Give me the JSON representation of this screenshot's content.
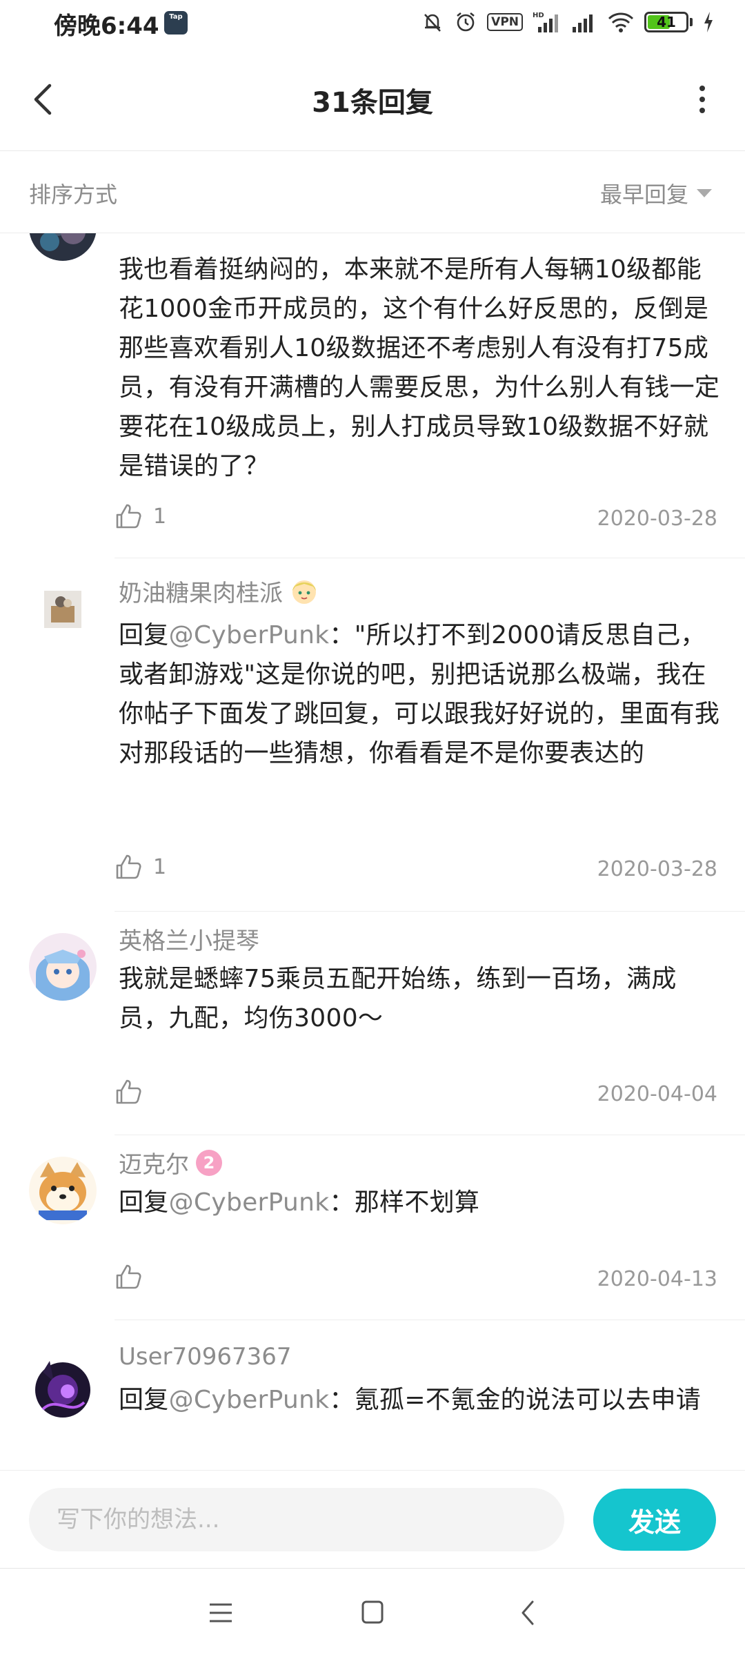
{
  "status_bar": {
    "time": "傍晚6:44",
    "app_icon": "taptap-icon",
    "app_icon_text": "Tap",
    "vpn": "VPN",
    "battery": "41"
  },
  "header": {
    "title": "31条回复"
  },
  "sort": {
    "label": "排序方式",
    "selected": "最早回复"
  },
  "comments": [
    {
      "username": "",
      "content": "我也看着挺纳闷的，本来就不是所有人每辆10级都能花1000金币开成员的，这个有什么好反思的，反倒是那些喜欢看别人10级数据还不考虑别人有没有打75成员，有没有开满槽的人需要反思，为什么别人有钱一定要花在10级成员上，别人打成员导致10级数据不好就是错误的了？",
      "likes": "1",
      "date": "2020-03-28"
    },
    {
      "username": "奶油糖果肉桂派",
      "reply_prefix": "回复",
      "mention": "@CyberPunk",
      "content": "：\"所以打不到2000请反思自己，或者卸游戏\"这是你说的吧，别把话说那么极端，我在你帖子下面发了跳回复，可以跟我好好说的，里面有我对那段话的一些猜想，你看看是不是你要表达的",
      "likes": "1",
      "date": "2020-03-28"
    },
    {
      "username": "英格兰小提琴",
      "content": "我就是蟋蟀75乘员五配开始练，练到一百场，满成员，九配，均伤3000～",
      "likes": "",
      "date": "2020-04-04"
    },
    {
      "username": "迈克尔",
      "level": "2",
      "reply_prefix": "回复",
      "mention": "@CyberPunk",
      "content": "：那样不划算",
      "likes": "",
      "date": "2020-04-13"
    },
    {
      "username": "User70967367",
      "reply_prefix": "回复",
      "mention": "@CyberPunk",
      "content": "：氪孤=不氪金的说法可以去申请"
    }
  ],
  "input": {
    "placeholder": "写下你的想法...",
    "send_label": "发送"
  },
  "colors": {
    "accent": "#15c5ce",
    "secondary_text": "#8c8c8c",
    "level_badge": "#f7a1c4"
  }
}
